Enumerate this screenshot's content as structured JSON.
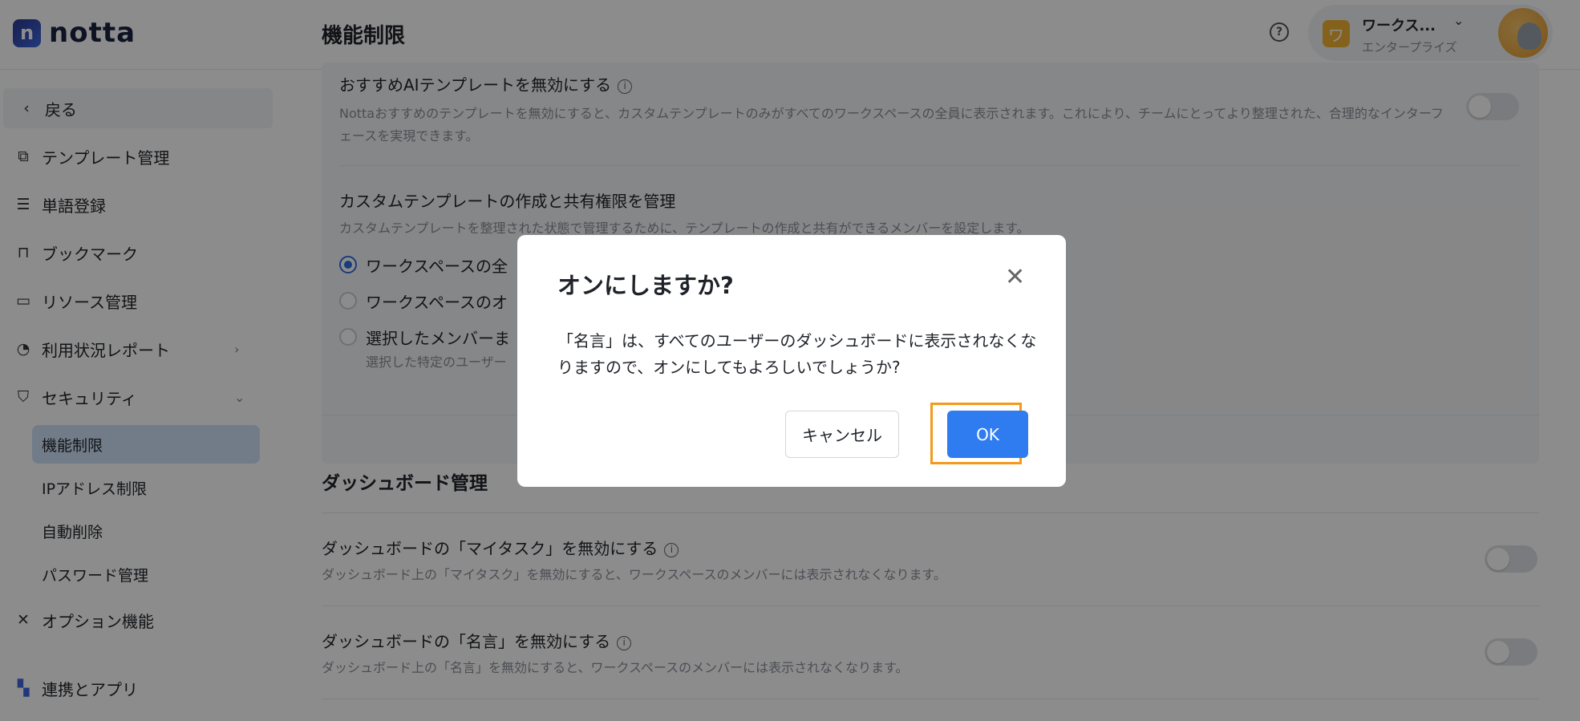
{
  "app": {
    "logo_mark": "n",
    "logo_text": "notta"
  },
  "header": {
    "page_title": "機能制限",
    "help_icon": "?",
    "workspace": {
      "badge": "ワ",
      "name": "ワークス...",
      "plan": "エンタープライズ"
    }
  },
  "sidebar": {
    "back": "戻る",
    "items": [
      {
        "label": "テンプレート管理",
        "icon": "template-icon"
      },
      {
        "label": "単語登録",
        "icon": "list-icon"
      },
      {
        "label": "ブックマーク",
        "icon": "bookmark-icon"
      },
      {
        "label": "リソース管理",
        "icon": "folder-settings-icon"
      },
      {
        "label": "利用状況レポート",
        "icon": "pie-chart-icon"
      },
      {
        "label": "セキュリティ",
        "icon": "shield-icon"
      }
    ],
    "security_sub": [
      "機能制限",
      "IPアドレス制限",
      "自動削除",
      "パスワード管理"
    ],
    "options": "オプション機能",
    "integrations": "連携とアプリ"
  },
  "main": {
    "ai_template": {
      "title": "おすすめAIテンプレートを無効にする",
      "desc": "Nottaおすすめのテンプレートを無効にすると、カスタムテンプレートのみがすべてのワークスペースの全員に表示されます。これにより、チームにとってより整理された、合理的なインターフェースを実現できます。"
    },
    "custom_template": {
      "title": "カスタムテンプレートの作成と共有権限を管理",
      "desc": "カスタムテンプレートを整理された状態で管理するために、テンプレートの作成と共有ができるメンバーを設定します。",
      "options": [
        "ワークスペースの全",
        "ワークスペースのオ",
        "選択したメンバーま"
      ],
      "option3_desc": "選択した特定のユーザー",
      "selected_index": 0
    },
    "dashboard": {
      "section_title": "ダッシュボード管理",
      "my_task": {
        "title": "ダッシュボードの「マイタスク」を無効にする",
        "desc": "ダッシュボード上の「マイタスク」を無効にすると、ワークスペースのメンバーには表示されなくなります。"
      },
      "quote": {
        "title": "ダッシュボードの「名言」を無効にする",
        "desc": "ダッシュボード上の「名言」を無効にすると、ワークスペースのメンバーには表示されなくなります。"
      }
    }
  },
  "modal": {
    "title": "オンにしますか?",
    "body": "「名言」は、すべてのユーザーのダッシュボードに表示されなくなりますので、オンにしてもよろしいでしょうか?",
    "cancel": "キャンセル",
    "ok": "OK"
  },
  "colors": {
    "primary": "#2f7cf0",
    "highlight": "#f39a1c",
    "active_nav": "#cfe2f7"
  }
}
